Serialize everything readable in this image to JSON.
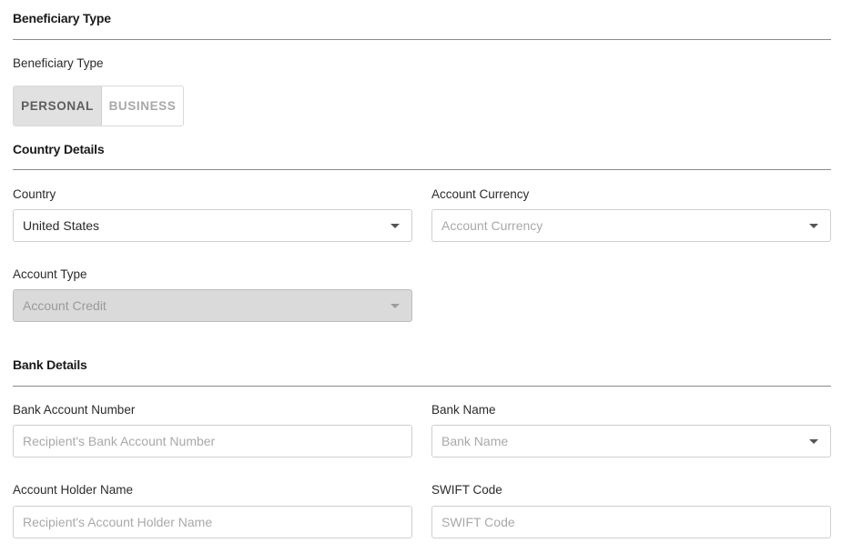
{
  "beneficiary": {
    "section_title": "Beneficiary Type",
    "field_label": "Beneficiary Type",
    "options": [
      "PERSONAL",
      "BUSINESS"
    ],
    "selected": "PERSONAL"
  },
  "country_details": {
    "section_title": "Country Details",
    "country": {
      "label": "Country",
      "value": "United States"
    },
    "account_currency": {
      "label": "Account Currency",
      "placeholder": "Account Currency"
    },
    "account_type": {
      "label": "Account Type",
      "placeholder": "Account Credit",
      "disabled": true
    }
  },
  "bank_details": {
    "section_title": "Bank Details",
    "bank_account_number": {
      "label": "Bank Account Number",
      "placeholder": "Recipient's Bank Account Number"
    },
    "bank_name": {
      "label": "Bank Name",
      "placeholder": "Bank Name"
    },
    "account_holder_name": {
      "label": "Account Holder Name",
      "placeholder": "Recipient's Account Holder Name"
    },
    "swift_code": {
      "label": "SWIFT Code",
      "placeholder": "SWIFT Code"
    }
  },
  "icons": {
    "dropdown": "chevron-down-icon"
  }
}
